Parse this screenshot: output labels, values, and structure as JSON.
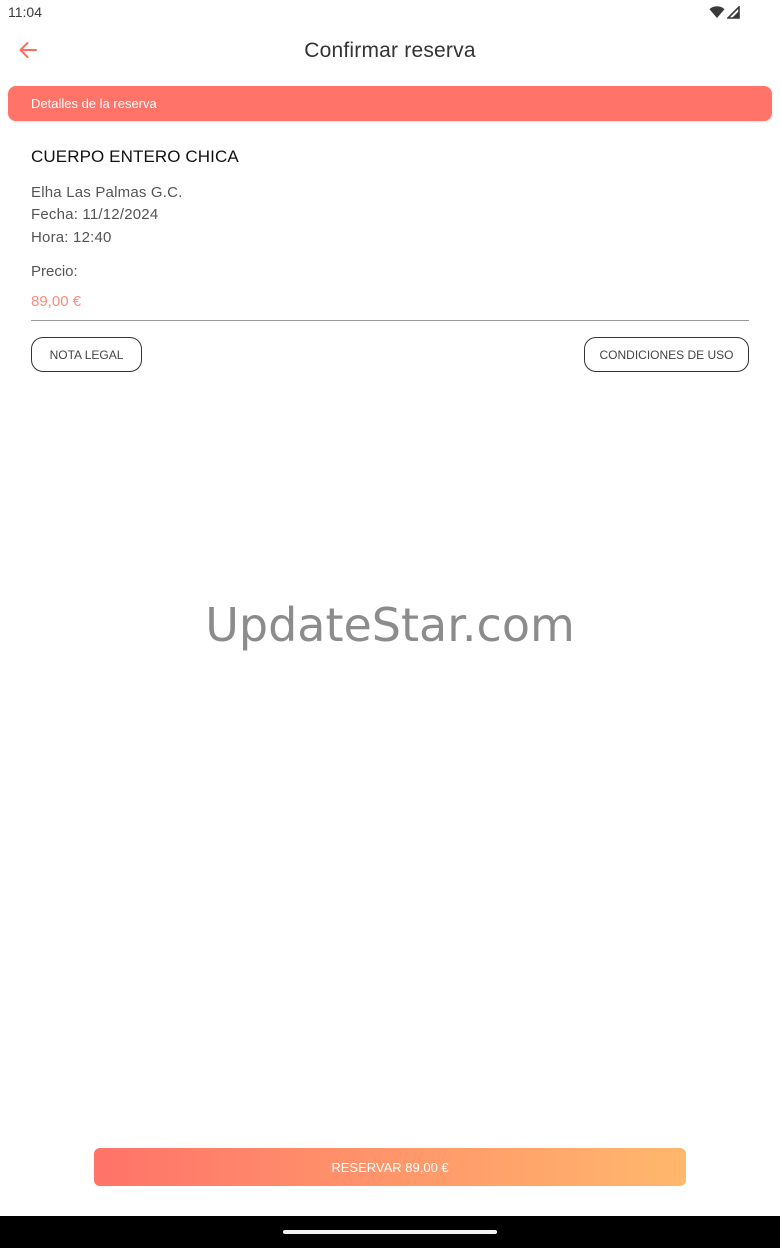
{
  "status_bar": {
    "time": "11:04",
    "icons": [
      "wifi-icon",
      "signal-icon"
    ]
  },
  "app_bar": {
    "title": "Confirmar reserva",
    "back_icon": "arrow-left-icon"
  },
  "section": {
    "header": "Detalles de la reserva"
  },
  "booking": {
    "service": "CUERPO ENTERO CHICA",
    "location": "Elha Las Palmas G.C.",
    "date": "Fecha: 11/12/2024",
    "time": "Hora: 12:40",
    "price_label": "Precio:",
    "price_value": "89,00  €"
  },
  "buttons": {
    "legal": "NOTA LEGAL",
    "terms": "CONDICIONES DE USO",
    "reserve": "RESERVAR 89,00  €"
  },
  "watermark": "UpdateStar.com",
  "colors": {
    "accent": "#ff7369",
    "gradient_end": "#ffb86c",
    "price": "#ff8a80"
  }
}
